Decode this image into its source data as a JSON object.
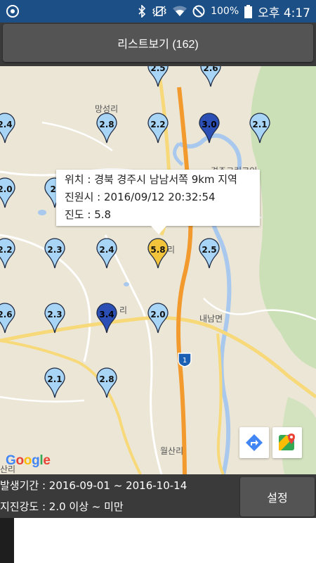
{
  "status_bar": {
    "battery": "100%",
    "time": "오후 4:17",
    "icons": [
      "app-icon",
      "bluetooth-icon",
      "vibrate-icon",
      "wifi-icon",
      "blocked-icon",
      "battery-icon"
    ]
  },
  "list_button": {
    "label": "리스트보기 (162)"
  },
  "map": {
    "places": [
      "망성리",
      "내남면",
      "월산리",
      "리",
      "리",
      "산리",
      "경주그린코인"
    ],
    "road_shield": "1",
    "markers": [
      {
        "value": "2.5",
        "level": "light"
      },
      {
        "value": "2.6",
        "level": "light"
      },
      {
        "value": "2.4",
        "level": "light"
      },
      {
        "value": "2.8",
        "level": "light"
      },
      {
        "value": "2.2",
        "level": "light"
      },
      {
        "value": "3.0",
        "level": "dark"
      },
      {
        "value": "2.1",
        "level": "light"
      },
      {
        "value": "2.0",
        "level": "light"
      },
      {
        "value": "2.",
        "level": "light"
      },
      {
        "value": "2.2",
        "level": "light"
      },
      {
        "value": "2.3",
        "level": "light"
      },
      {
        "value": "2.4",
        "level": "light"
      },
      {
        "value": "5.8",
        "level": "selected"
      },
      {
        "value": "2.5",
        "level": "light"
      },
      {
        "value": "2.6",
        "level": "light"
      },
      {
        "value": "2.3",
        "level": "light"
      },
      {
        "value": "3.4",
        "level": "dark"
      },
      {
        "value": "2.0",
        "level": "light"
      },
      {
        "value": "2.1",
        "level": "light"
      },
      {
        "value": "2.8",
        "level": "light"
      }
    ],
    "popup": {
      "location": "위치 : 경북 경주시 남남서쪽 9km 지역",
      "time": "진원시 : 2016/09/12 20:32:54",
      "magnitude": "진도 : 5.8"
    },
    "google_logo": "Google",
    "colors": {
      "light": "#a8d4f5",
      "dark": "#2c4fb5",
      "selected": "#f2c43c"
    }
  },
  "filter": {
    "period": "발생기간 : 2016-09-01 ~ 2016-10-14",
    "intensity": "지진강도 : 2.0 이상 ~  미만",
    "settings_label": "설정"
  }
}
